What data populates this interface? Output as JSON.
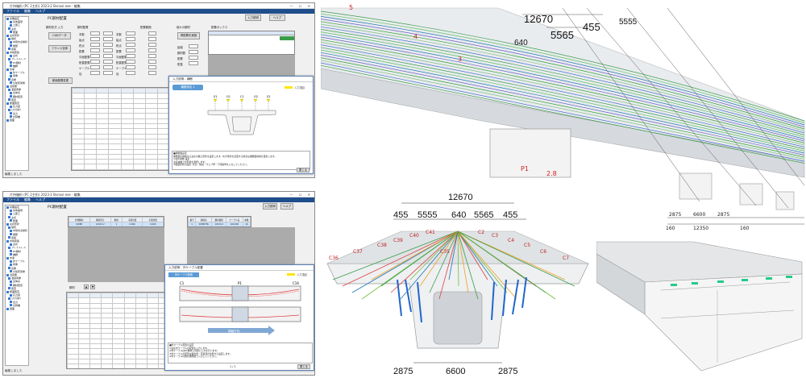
{
  "app1": {
    "title": "片持箱桁 (PC 2主桁) 2023-2 Bsnavi.exe - 編集",
    "menus": [
      "ファイル",
      "編集",
      "ヘルプ"
    ],
    "tree": [
      "初期設定",
      "基本事項",
      "上部工",
      "主桁",
      "断面",
      "主桁形状",
      "横桁",
      "中間支点横桁",
      "端部",
      "床版",
      "中間床版",
      "主桁",
      "プレストレス",
      "PC鋼材",
      "橋脚",
      "支承",
      "外ケーブル",
      "荷重",
      "自重",
      "付加死荷重",
      "活荷重",
      "温度荷重",
      "全体系",
      "鋼材配置",
      "照査",
      "断面照査",
      "応力度",
      "ひび割れ",
      "出力",
      "計算書",
      "図面"
    ],
    "heading": "PC鋼材配置",
    "group_labels": [
      "鋼材形式 入力",
      "鋼材配置",
      "配置範囲",
      "個々の鋼材",
      "配置ボックス"
    ],
    "buttons": [
      "CADデータ",
      "フランジ全体",
      "断面配置変更",
      "再配置を実施",
      "入力説明",
      "ヘルプ"
    ],
    "field_labels": [
      "本数",
      "始点",
      "終点",
      "配置",
      "平面配置",
      "鉛直配置",
      "ケーブル",
      "径"
    ],
    "info_labels": [
      "始端",
      "鋼材数",
      "配置",
      "鉛直"
    ],
    "dialog_title": "入力説明 - 横断",
    "dialog_tab": "横断設定 1",
    "legend_input": "入力項目",
    "dialog_labels": [
      "S1",
      "G1",
      "C1",
      "G2",
      "S2"
    ],
    "dialog_text": [
      "■横断面設定",
      "横断面を構成する主桁の数と形状を設定します。桁の形状を変更する場合は横断面情報を更新します。",
      "①主桁本数 設定",
      "主桁本数と桁形状を選択します。",
      "②断面形状の設定: 桁高・幅員・ウェブ厚・下床版厚を入力してください。"
    ],
    "close_button": "閉じる",
    "status": "編集しました"
  },
  "app2": {
    "title": "片持箱桁 (PC 2主桁) 2023-2 Bsnavi.exe - 編集",
    "menus": [
      "ファイル",
      "編集",
      "ヘルプ"
    ],
    "tree": [
      "初期設定",
      "基本事項",
      "上部工",
      "主桁",
      "断面",
      "主桁形状",
      "横桁",
      "中間支点横桁",
      "端部",
      "床版",
      "中間床版",
      "主桁",
      "プレストレス",
      "PC鋼材",
      "橋脚",
      "支承",
      "外ケーブル",
      "荷重",
      "自重",
      "付加死荷重",
      "活荷重",
      "温度荷重",
      "全体系",
      "鋼材配置",
      "照査",
      "断面照査",
      "応力度",
      "ひび割れ",
      "出力",
      "計算書",
      "図面"
    ],
    "heading": "PC鋼材配置",
    "top_grid_header": [
      "外側鋼材",
      "鋼材区分",
      "鋼材",
      "平面位置",
      "平面位置"
    ],
    "top_grid_row": [
      "SWPR",
      "12S15.2",
      "1",
      "0.000",
      "0.000"
    ],
    "right_grid_header": [
      "番号",
      "鋼材名",
      "鋼材種別",
      "ケーブル長",
      "本数"
    ],
    "right_grid_row": [
      "1",
      "SWPR7BL",
      "12S15.2",
      "100.000",
      "16"
    ],
    "list_label": "鋼材",
    "dialog_title": "入力説明 - 外ケーブル配置",
    "dialog_tab": "外ケーブル配置",
    "legend_input": "入力項目",
    "dialog_labels": [
      "C1",
      "P1",
      "C16"
    ],
    "arrow_text": "橋軸方向",
    "dialog_text": [
      "■外ケーブル配置の設定",
      "①主桁外ケーブルの配置を入力します。",
      "②外ケーブルはPC鋼材と同様に入力を行います。",
      "③外ケーブルの配置は偏向部・定着部の位置から設定します。",
      "④外ケーブルの数を鋼材数で入力してください。"
    ],
    "close_button": "閉じる",
    "page": "1 / 1",
    "status": "編集しました"
  },
  "render_top": {
    "dims": [
      "12670",
      "5565",
      "640",
      "455",
      "5555"
    ],
    "marks": [
      "5",
      "4",
      "3",
      "P1",
      "2.8"
    ],
    "bottom_dims": [
      "2875",
      "6600",
      "2875",
      "12350",
      "160",
      "160"
    ]
  },
  "render_section": {
    "top_dim": "12670",
    "dims": [
      "455",
      "5555",
      "640",
      "5565",
      "455"
    ],
    "labels": [
      "C36",
      "C37",
      "C38",
      "C39",
      "C40",
      "C41",
      "C35",
      "C2",
      "C3",
      "C4",
      "C5",
      "C6",
      "C7"
    ],
    "bottom_dims": [
      "2875",
      "6600",
      "2875"
    ]
  }
}
